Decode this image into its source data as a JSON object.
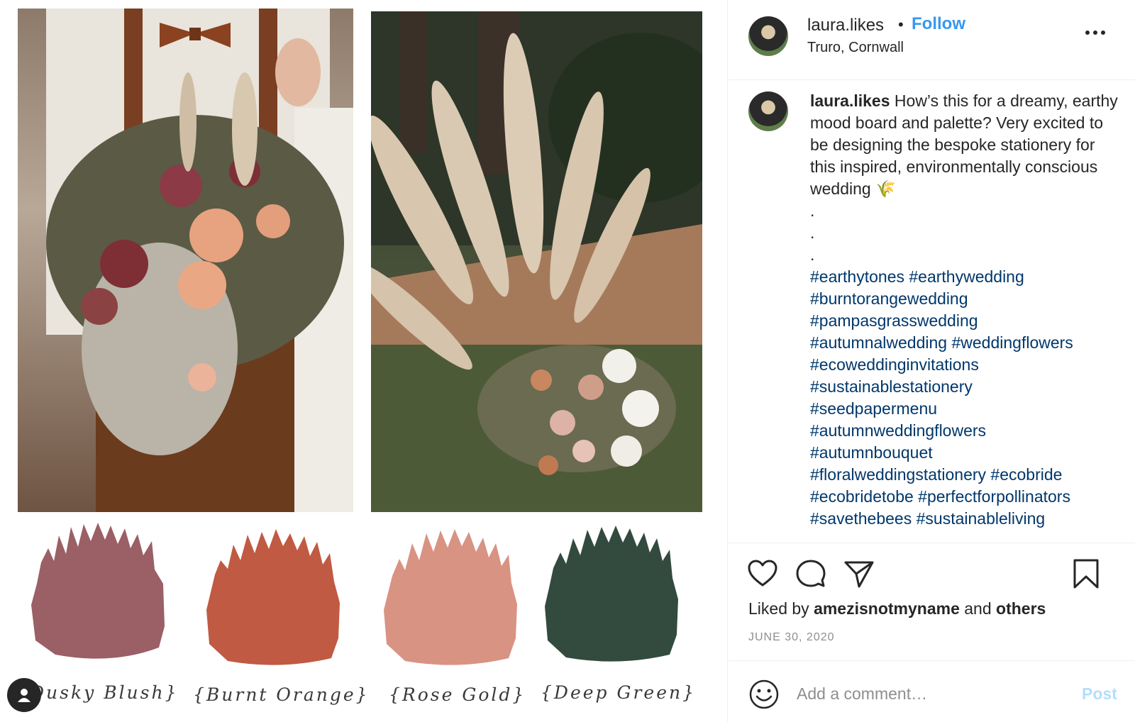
{
  "post": {
    "username": "laura.likes",
    "separator": "•",
    "follow_label": "Follow",
    "location": "Truro, Cornwall"
  },
  "caption": {
    "username": "laura.likes",
    "text": "How’s this for a dreamy, earthy mood board and palette? Very excited to be designing the bespoke stationery for this inspired, environmentally conscious wedding 🌾",
    "dots": [
      ".",
      ".",
      "."
    ],
    "hashtag_lines": [
      "#earthytones #earthywedding",
      "#burntorangewedding",
      "#pampasgrasswedding",
      "#autumnalwedding #weddingflowers",
      "#ecoweddinginvitations",
      "#sustainablestationery",
      "#seedpapermenu",
      "#autumnweddingflowers",
      "#autumnbouquet",
      "#floralweddingstationery #ecobride",
      "#ecobridetobe #perfectforpollinators",
      "#savethebees #sustainableliving"
    ]
  },
  "engagement": {
    "liked_by_prefix": "Liked by",
    "liked_by_user": "amezisnotmyname",
    "liked_by_and": "and",
    "liked_by_others": "others",
    "date": "JUNE 30, 2020"
  },
  "comment": {
    "placeholder": "Add a comment…",
    "post_label": "Post"
  },
  "media": {
    "swatches": [
      {
        "label": "Dusky Blush}",
        "color": "#9b5f66"
      },
      {
        "label": "{Burnt Orange}",
        "color": "#c05a43"
      },
      {
        "label": "{Rose Gold}",
        "color": "#d89383"
      },
      {
        "label": "{Deep Green}",
        "color": "#334a3f"
      }
    ]
  },
  "colors": {
    "link_blue": "#3897f0",
    "hashtag": "#00376b",
    "muted": "#8e8e8e",
    "post_disabled": "#b2dffc"
  },
  "icons": {
    "like": "heart-icon",
    "comment": "comment-icon",
    "share": "share-icon",
    "save": "bookmark-icon",
    "emoji": "emoji-icon",
    "more": "more-icon",
    "profile": "user-icon"
  }
}
